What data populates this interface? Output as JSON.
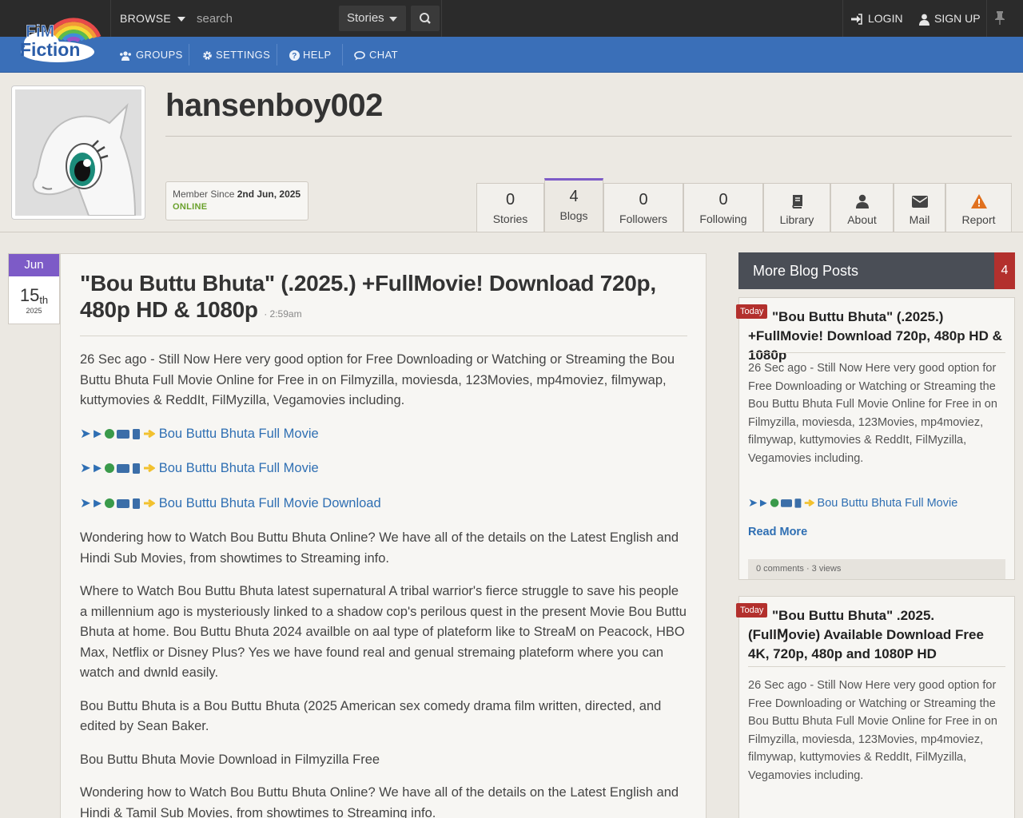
{
  "topbar": {
    "logo_line1": "FiM",
    "logo_line2": "Fiction",
    "browse_label": "BROWSE",
    "search_placeholder": "search",
    "search_type": "Stories",
    "login_label": "LOGIN",
    "signup_label": "SIGN UP"
  },
  "nav": {
    "groups": "GROUPS",
    "settings": "SETTINGS",
    "help": "HELP",
    "chat": "CHAT"
  },
  "colors": {
    "topbar": "#2b2b2b",
    "nav": "#3a6fb8",
    "accent": "#7d5bc7",
    "badge": "#b3302d",
    "link": "#2f6fb3",
    "online": "#6aa12c"
  },
  "profile": {
    "username": "hansenboy002",
    "member_since_label": "Member Since",
    "member_since_date": "2nd Jun, 2025",
    "status": "ONLINE"
  },
  "tabs": [
    {
      "num": "0",
      "label": "Stories"
    },
    {
      "num": "4",
      "label": "Blogs"
    },
    {
      "num": "0",
      "label": "Followers"
    },
    {
      "num": "0",
      "label": "Following"
    },
    {
      "num": "",
      "label": "Library",
      "icon": "book-icon"
    },
    {
      "num": "",
      "label": "About",
      "icon": "user-icon"
    },
    {
      "num": "",
      "label": "Mail",
      "icon": "mail-icon"
    },
    {
      "num": "",
      "label": "Report",
      "icon": "warning-icon"
    }
  ],
  "post": {
    "date_month": "Jun",
    "date_day": "15",
    "date_suffix": "th",
    "date_year": "2025",
    "title": "\"Bou Buttu Bhuta\" (.2025.) +FullMovie! Download 720p, 480p HD & 1080p",
    "time": "· 2:59am",
    "paragraphs": {
      "p1": "26 Sec ago - Still Now Here very good option for Free Downloading or Watching or Streaming the Bou Buttu Bhuta Full Movie Online for Free in on Filmyzilla, moviesda, 123Movies, mp4moviez, filmywap, kuttymovies & ReddIt, FilMyzilla, Vegamovies including.",
      "link_prefix": "➤►",
      "link1": "Bou Buttu Bhuta Full Movie",
      "link2": "Bou Buttu Bhuta Full Movie",
      "link3": "Bou Buttu Bhuta Full Movie Download",
      "p2": "Wondering how to Watch Bou Buttu Bhuta Online? We have all of the details on the Latest English and Hindi Sub Movies, from showtimes to Streaming info.",
      "p3": "Where to Watch Bou Buttu Bhuta latest supernatural A tribal warrior's fierce struggle to save his people a millennium ago is mysteriously linked to a shadow cop's perilous quest in the present Movie Bou Buttu Bhuta at home. Bou Buttu Bhuta 2024 availble on aal type of plateform like to StreaM on Peacock, HBO Max, Netflix or Disney Plus? Yes we have found real and genual stremaing plateform where you can watch and dwnld easily.",
      "p4": "Bou Buttu Bhuta is a Bou Buttu Bhuta (2025 American sex comedy drama film written, directed, and edited by Sean Baker.",
      "p5": "Bou Buttu Bhuta Movie Download in Filmyzilla Free",
      "p6": "Wondering how to Watch Bou Buttu Bhuta Online? We have all of the details on the Latest English and Hindi & Tamil Sub Movies, from showtimes to Streaming info."
    }
  },
  "sidebar": {
    "header": "More Blog Posts",
    "count": "4",
    "cards": [
      {
        "badge": "Today",
        "title": "\"Bou Buttu Bhuta\" (.2025.) +FullMovie! Download 720p, 480p HD & 1080p",
        "body": "26 Sec ago - Still Now Here very good option for Free Downloading or Watching or Streaming the Bou Buttu Bhuta Full Movie Online for Free in on Filmyzilla, moviesda, 123Movies, mp4moviez, filmywap, kuttymovies & ReddIt, FilMyzilla, Vegamovies including.",
        "link": "Bou Buttu Bhuta Full Movie",
        "read_more": "Read More",
        "stats": "0 comments · 3 views"
      },
      {
        "badge": "Today",
        "title": "\"Bou Buttu Bhuta\" .2025.(FullⱮovie) Available Download Free 4K, 720p, 480p and 1080P HD",
        "body": "26 Sec ago - Still Now Here very good option for Free Downloading or Watching or Streaming the Bou Buttu Bhuta Full Movie Online for Free in on Filmyzilla, moviesda, 123Movies, mp4moviez, filmywap, kuttymovies & ReddIt, FilMyzilla, Vegamovies including."
      }
    ]
  }
}
